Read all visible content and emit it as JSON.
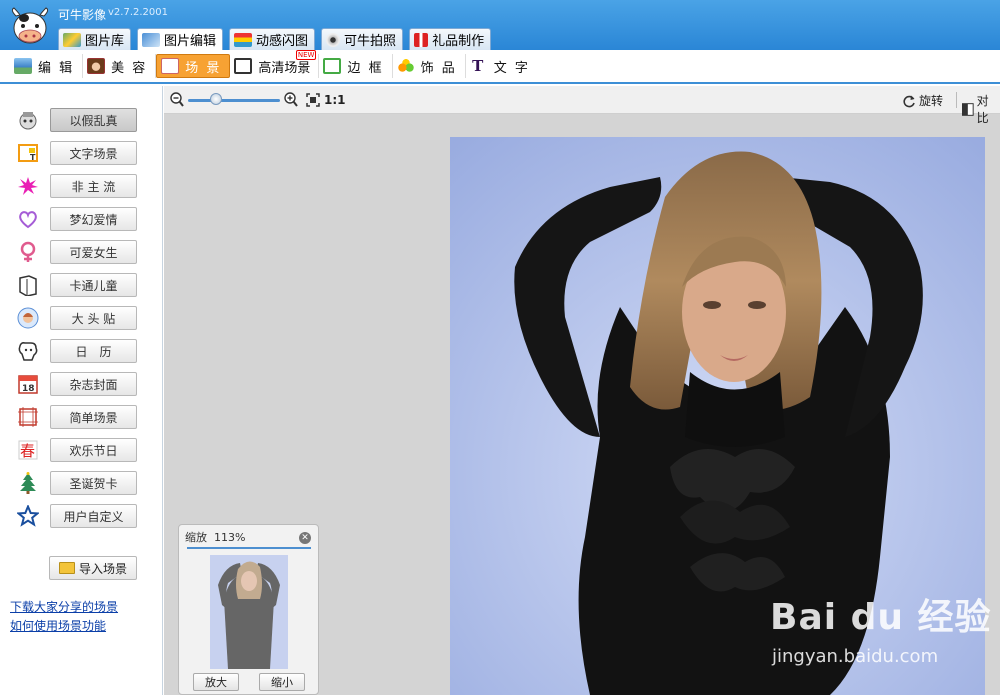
{
  "app": {
    "title": "可牛影像",
    "version": "v2.7.2.2001",
    "colors": {
      "titlebar": "#2a86d6",
      "accent": "#f7a233"
    }
  },
  "main_tabs": [
    {
      "label": "图片库",
      "icon": "gallery-icon"
    },
    {
      "label": "图片编辑",
      "icon": "photo-edit-icon",
      "active": true
    },
    {
      "label": "动感闪图",
      "icon": "flash-gif-icon"
    },
    {
      "label": "可牛拍照",
      "icon": "webcam-icon"
    },
    {
      "label": "礼品制作",
      "icon": "gift-icon"
    }
  ],
  "sub_tabs": [
    {
      "label": "编 辑",
      "icon": "edit-image-icon"
    },
    {
      "label": "美 容",
      "icon": "beauty-face-icon"
    },
    {
      "label": "场 景",
      "icon": "scene-icon",
      "active": true
    },
    {
      "label": "高清场景",
      "icon": "hd-scene-icon",
      "badge": "NEW"
    },
    {
      "label": "边 框",
      "icon": "frame-icon"
    },
    {
      "label": "饰 品",
      "icon": "accessory-icon"
    },
    {
      "label": "文 字",
      "icon": "text-icon"
    }
  ],
  "sidebar": {
    "items": [
      {
        "label": "以假乱真",
        "icon": "fake-real-icon",
        "active": true
      },
      {
        "label": "文字场景",
        "icon": "text-scene-icon"
      },
      {
        "label": "非 主 流",
        "icon": "splash-icon"
      },
      {
        "label": "梦幻爱情",
        "icon": "heart-icon"
      },
      {
        "label": "可爱女生",
        "icon": "female-icon"
      },
      {
        "label": "卡通儿童",
        "icon": "cartoon-book-icon"
      },
      {
        "label": "大 头 贴",
        "icon": "sticker-face-icon"
      },
      {
        "label": "日　历",
        "icon": "calendar-dog-icon"
      },
      {
        "label": "杂志封面",
        "icon": "calendar-18-icon"
      },
      {
        "label": "简单场景",
        "icon": "simple-frame-icon"
      },
      {
        "label": "欢乐节日",
        "icon": "spring-festival-icon"
      },
      {
        "label": "圣诞贺卡",
        "icon": "christmas-tree-icon"
      },
      {
        "label": "用户自定义",
        "icon": "star-icon"
      }
    ],
    "import_label": "导入场景",
    "link_download": "下载大家分享的场景",
    "link_help": "如何使用场景功能"
  },
  "view_toolbar": {
    "actual_size_label": "1:1",
    "rotate_label": "旋转",
    "compare_label": "对比"
  },
  "navigator": {
    "title": "缩放",
    "zoom": "113%",
    "zoom_in_label": "放大",
    "zoom_out_label": "缩小",
    "view_fraction": 0.55
  },
  "zoom_slider": {
    "value": 0.3
  },
  "watermark": {
    "logo": "Bai du 经验",
    "url": "jingyan.baidu.com"
  }
}
